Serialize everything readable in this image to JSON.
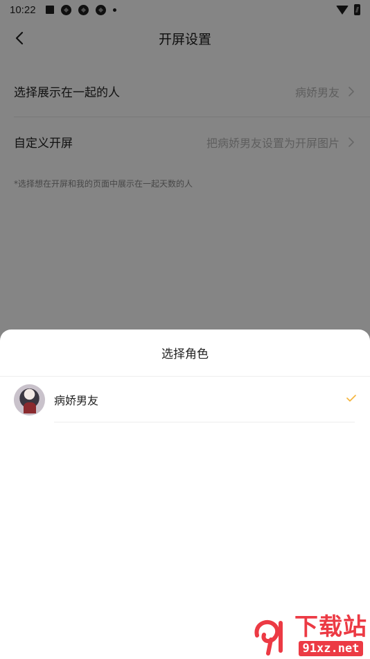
{
  "status_bar": {
    "time": "10:22"
  },
  "nav": {
    "title": "开屏设置"
  },
  "settings": {
    "rows": [
      {
        "label": "选择展示在一起的人",
        "value": "病娇男友"
      },
      {
        "label": "自定义开屏",
        "value": "把病娇男友设置为开屏图片"
      }
    ],
    "hint": "*选择想在开屏和我的页面中展示在一起天数的人"
  },
  "sheet": {
    "title": "选择角色",
    "roles": [
      {
        "name": "病娇男友",
        "selected": true
      }
    ]
  },
  "watermark": {
    "title": "下载站",
    "url": "91xz.net"
  },
  "colors": {
    "accent_check": "#f5b53d",
    "overlay": "rgba(0,0,0,0.48)",
    "watermark_red": "#ec3a44"
  }
}
